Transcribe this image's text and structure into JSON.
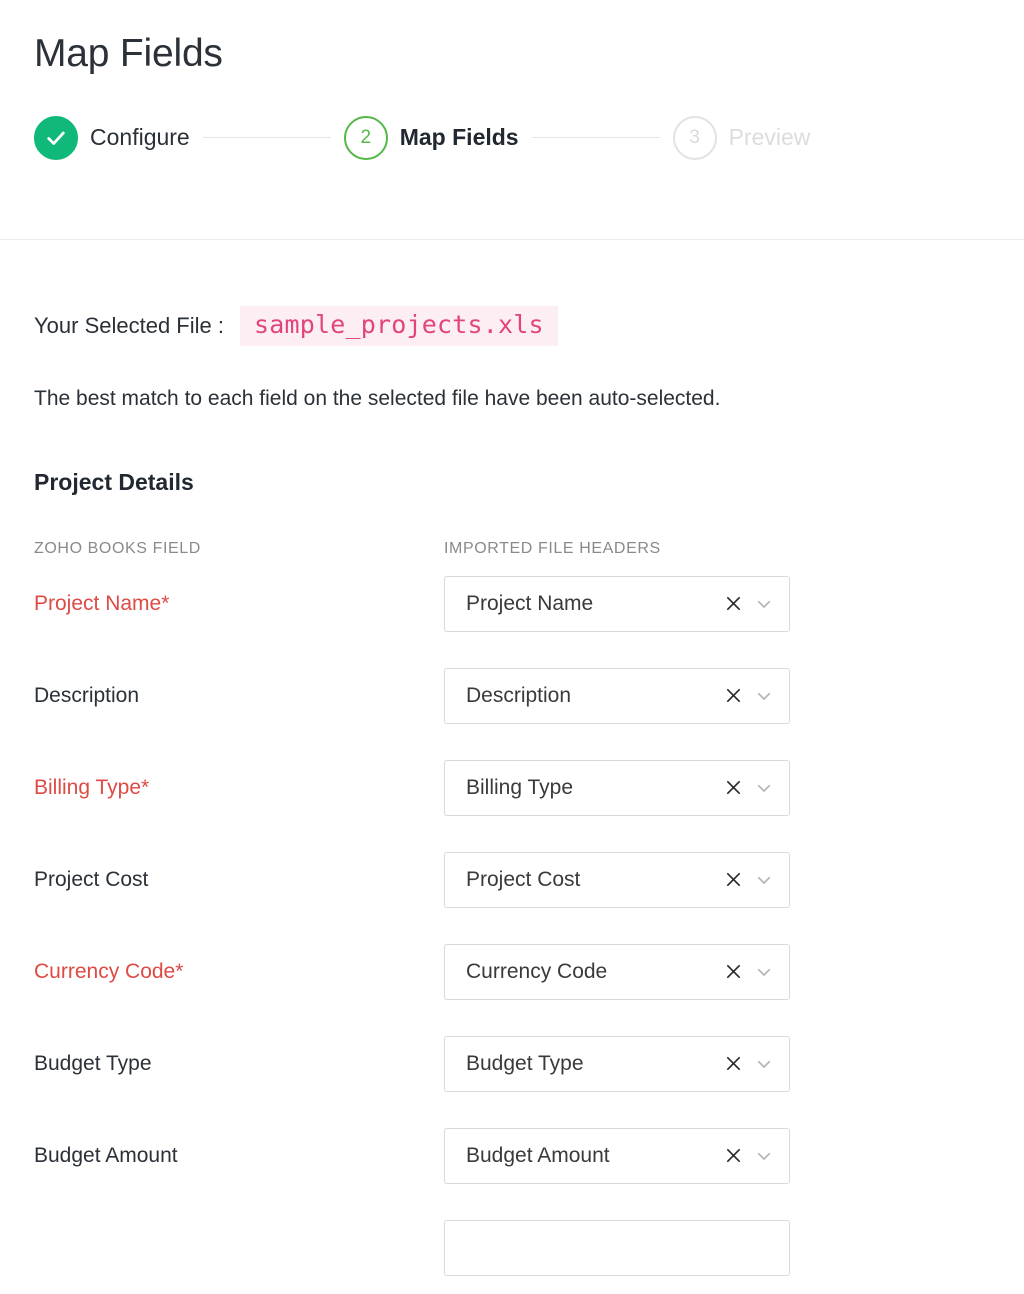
{
  "header": {
    "title": "Map Fields"
  },
  "stepper": {
    "steps": [
      {
        "num": "1",
        "label": "Configure",
        "state": "done",
        "icon": "check-icon"
      },
      {
        "num": "2",
        "label": "Map Fields",
        "state": "current",
        "icon": ""
      },
      {
        "num": "3",
        "label": "Preview",
        "state": "upcoming",
        "icon": ""
      }
    ]
  },
  "file": {
    "label": "Your Selected File :",
    "name": "sample_projects.xls"
  },
  "help_text": "The best match to each field on the selected file have been auto-selected.",
  "section": {
    "title": "Project Details"
  },
  "table": {
    "headers": {
      "left": "ZOHO BOOKS FIELD",
      "right": "IMPORTED FILE HEADERS"
    },
    "rows": [
      {
        "field": "Project Name*",
        "required": true,
        "value": "Project Name",
        "clear_icon": "close-icon",
        "chevron_icon": "chevron-down-icon"
      },
      {
        "field": "Description",
        "required": false,
        "value": "Description",
        "clear_icon": "close-icon",
        "chevron_icon": "chevron-down-icon"
      },
      {
        "field": "Billing Type*",
        "required": true,
        "value": "Billing Type",
        "clear_icon": "close-icon",
        "chevron_icon": "chevron-down-icon"
      },
      {
        "field": "Project Cost",
        "required": false,
        "value": "Project Cost",
        "clear_icon": "close-icon",
        "chevron_icon": "chevron-down-icon"
      },
      {
        "field": "Currency Code*",
        "required": true,
        "value": "Currency Code",
        "clear_icon": "close-icon",
        "chevron_icon": "chevron-down-icon"
      },
      {
        "field": "Budget Type",
        "required": false,
        "value": "Budget Type",
        "clear_icon": "close-icon",
        "chevron_icon": "chevron-down-icon"
      },
      {
        "field": "Budget Amount",
        "required": false,
        "value": "Budget Amount",
        "clear_icon": "close-icon",
        "chevron_icon": "chevron-down-icon"
      }
    ]
  },
  "colors": {
    "accent_green": "#10b97a",
    "current_green": "#52b947",
    "required_red": "#de4b45",
    "file_pink": "#e2457e",
    "file_pink_bg": "#fdeef3",
    "muted_gray": "#8a8a8a",
    "upcoming_gray": "#dcdcdc"
  }
}
